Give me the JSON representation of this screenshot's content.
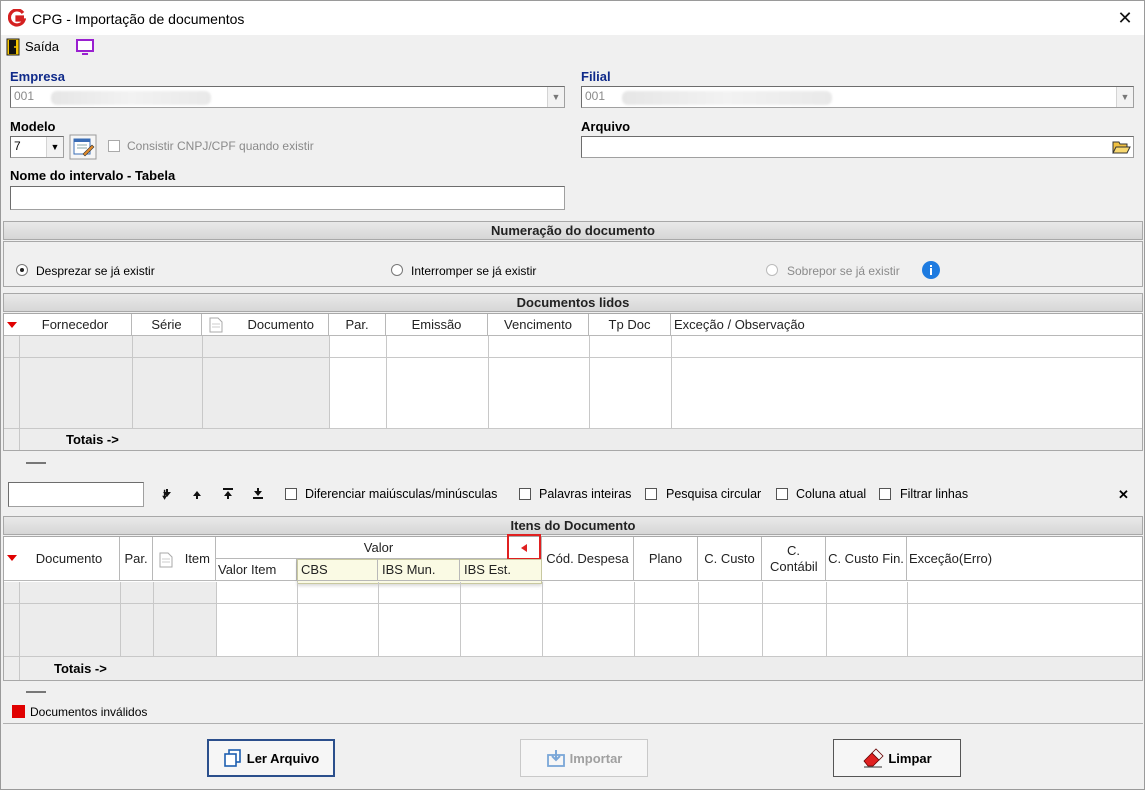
{
  "window": {
    "title": "CPG - Importação de documentos",
    "close": "✕"
  },
  "toolbar": {
    "exit_label": "Saída"
  },
  "empresa": {
    "label": "Empresa",
    "value": "001"
  },
  "filial": {
    "label": "Filial",
    "value": "001"
  },
  "modelo": {
    "label": "Modelo",
    "value": "7",
    "consistir_label": "Consistir CNPJ/CPF quando existir"
  },
  "arquivo": {
    "label": "Arquivo",
    "value": ""
  },
  "intervalo": {
    "label": "Nome do intervalo - Tabela",
    "value": ""
  },
  "numeracao": {
    "title": "Numeração do documento",
    "options": [
      "Desprezar se já existir",
      "Interromper se já existir",
      "Sobrepor se já existir"
    ],
    "selected": "Desprezar se já existir"
  },
  "documentos": {
    "title": "Documentos lidos",
    "columns": [
      "Fornecedor",
      "Série",
      "Documento",
      "Par.",
      "Emissão",
      "Vencimento",
      "Tp Doc",
      "Exceção / Observação"
    ],
    "totals": "Totais ->"
  },
  "search": {
    "value": "",
    "options": [
      "Diferenciar maiúsculas/minúsculas",
      "Palavras inteiras",
      "Pesquisa circular",
      "Coluna atual",
      "Filtrar linhas"
    ],
    "close": "✕"
  },
  "itens": {
    "title": "Itens do Documento",
    "columns": [
      "Documento",
      "Par.",
      "Item",
      "Cód. Despesa",
      "Plano",
      "C. Custo",
      "C. Contábil",
      "C. Custo Fin.",
      "Exceção(Erro)"
    ],
    "valor_group": "Valor",
    "valor_columns": [
      "Valor Item",
      "CBS",
      "IBS Mun.",
      "IBS Est."
    ],
    "totals": "Totais ->"
  },
  "legend": {
    "invalid": "Documentos inválidos",
    "invalid_color": "#e00000"
  },
  "buttons": {
    "ler": "Ler Arquivo",
    "importar": "Importar",
    "limpar": "Limpar"
  },
  "colors": {
    "accent_blue": "#0f2a8a",
    "highlight_red": "#e02020",
    "brand_red": "#d42020"
  }
}
